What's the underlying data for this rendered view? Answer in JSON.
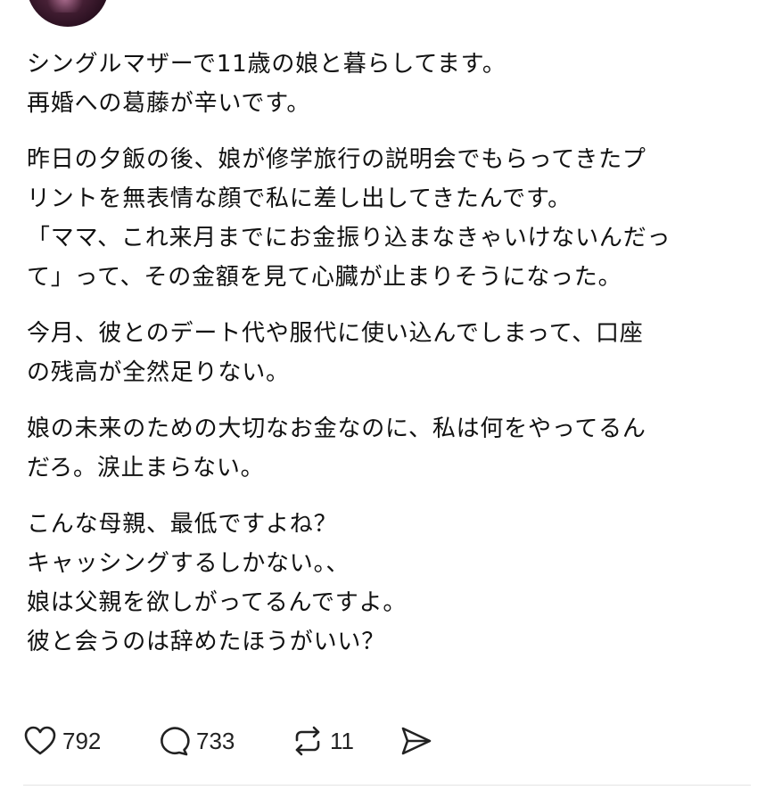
{
  "post": {
    "paragraphs": [
      [
        "シングルマザーで11歳の娘と暮らしてます。",
        "再婚への葛藤が辛いです。"
      ],
      [
        "昨日の夕飯の後、娘が修学旅行の説明会でもらってきたプ",
        "リントを無表情な顔で私に差し出してきたんです。",
        "「ママ、これ来月までにお金振り込まなきゃいけないんだっ",
        "て」って、その金額を見て心臓が止まりそうになった。"
      ],
      [
        "今月、彼とのデート代や服代に使い込んでしまって、口座",
        "の残高が全然足りない。"
      ],
      [
        "娘の未来のための大切なお金なのに、私は何をやってるん",
        "だろ。涙止まらない。"
      ],
      [
        "こんな母親、最低ですよね？",
        "キャッシングするしかない。、",
        "娘は父親を欲しがってるんですよ。",
        "彼と会うのは辞めたほうがいい？"
      ]
    ]
  },
  "actions": {
    "like": {
      "icon": "heart-icon",
      "count": "792"
    },
    "reply": {
      "icon": "comment-bubble-icon",
      "count": "733"
    },
    "repost": {
      "icon": "repost-icon",
      "count": "11"
    },
    "share": {
      "icon": "send-icon"
    }
  }
}
